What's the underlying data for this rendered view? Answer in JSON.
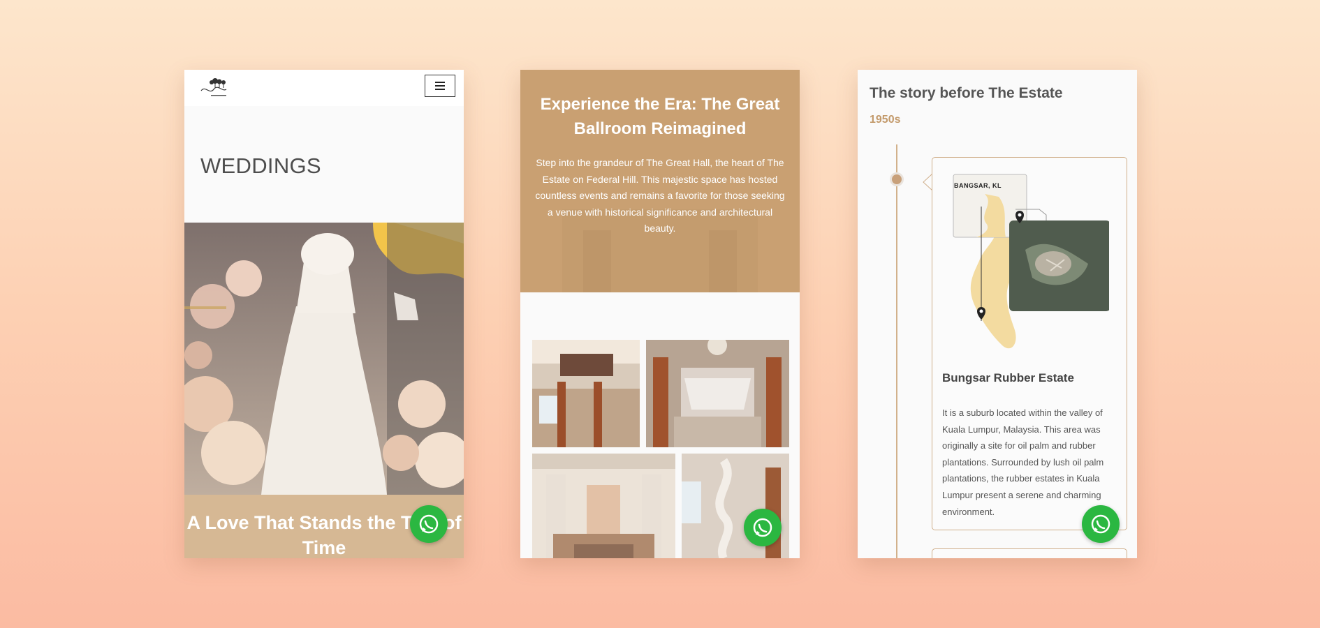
{
  "screen1": {
    "page_title": "WEDDINGS",
    "hero_heading": "A Love That Stands the Test of Time",
    "icons": {
      "menu": "hamburger-icon",
      "chat": "whatsapp-icon",
      "logo": "estate-logo"
    }
  },
  "screen2": {
    "heading": "Experience the Era: The Great Ballroom Reimagined",
    "body": "Step into the grandeur of The Great Hall, the heart of The Estate on Federal Hill. This majestic space has hosted countless events and remains a favorite for those seeking a venue with historical significance and architectural beauty."
  },
  "screen3": {
    "heading": "The story before The Estate",
    "decade": "1950s",
    "map_label": "BANGSAR, KL",
    "card_title": "Bungsar Rubber Estate",
    "card_body": "It is a suburb located within the valley of Kuala Lumpur, Malaysia. This area was originally a site for oil palm and rubber plantations. Surrounded by lush oil palm plantations, the rubber estates in Kuala Lumpur present a serene and charming environment."
  },
  "colors": {
    "accent_tan": "#c9a072",
    "whatsapp_green": "#2bb741",
    "timeline": "#d2b18b",
    "background_top": "#fde6cc",
    "background_bottom": "#fbbba2"
  }
}
